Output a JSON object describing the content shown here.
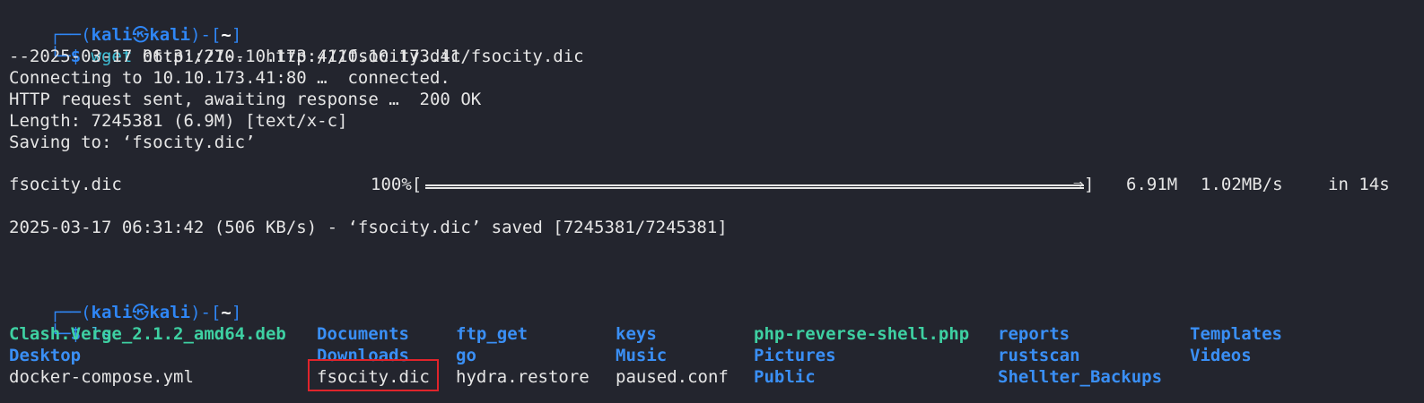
{
  "prompt1": {
    "top_frame": "┌──(",
    "user": "kali",
    "skull": "㉿",
    "host": "kali",
    "close": ")-[",
    "path": "~",
    "end": "]",
    "bottom_frame": "└─",
    "dollar": "$ ",
    "cmd": "wget",
    "arg": " http://10.10.173.41/fsocity.dic"
  },
  "output": {
    "l1": "--2025-03-17 06:31:27--  http://10.10.173.41/fsocity.dic",
    "l2": "Connecting to 10.10.173.41:80 …  connected.",
    "l3": "HTTP request sent, awaiting response …  200 OK",
    "l4": "Length: 7245381 (6.9M) [text/x-c]",
    "l5": "Saving to: ‘fsocity.dic’",
    "progress_name": "fsocity.dic",
    "progress_pct": "100%[",
    "progress_value": 1.0,
    "progress_end": "]",
    "progress_size": "6.91M",
    "progress_rate": "1.02MB/s",
    "progress_time": "in 14s",
    "l7": "2025-03-17 06:31:42 (506 KB/s) - ‘fsocity.dic’ saved [7245381/7245381]"
  },
  "prompt2": {
    "top_frame": "┌──(",
    "user": "kali",
    "skull": "㉿",
    "host": "kali",
    "close": ")-[",
    "path": "~",
    "end": "]",
    "bottom_frame": "└─",
    "dollar": "$ ",
    "cmd": "ls"
  },
  "ls": {
    "row1": [
      "Clash.Verge_2.1.2_amd64.deb",
      "Documents",
      "ftp_get",
      "keys",
      "php-reverse-shell.php",
      "reports",
      "Templates"
    ],
    "row2": [
      "Desktop",
      "Downloads",
      "go",
      "Music",
      "Pictures",
      "rustscan",
      "Videos"
    ],
    "row3": [
      "docker-compose.yml",
      "fsocity.dic",
      "hydra.restore",
      "paused.conf",
      "Public",
      "Shellter_Backups"
    ]
  },
  "colors": {
    "background": "#23252e",
    "prompt_blue": "#2f86f5",
    "directory_blue": "#3a8ff5",
    "package_green": "#3ed0a2",
    "highlight_red": "#e0242b"
  }
}
